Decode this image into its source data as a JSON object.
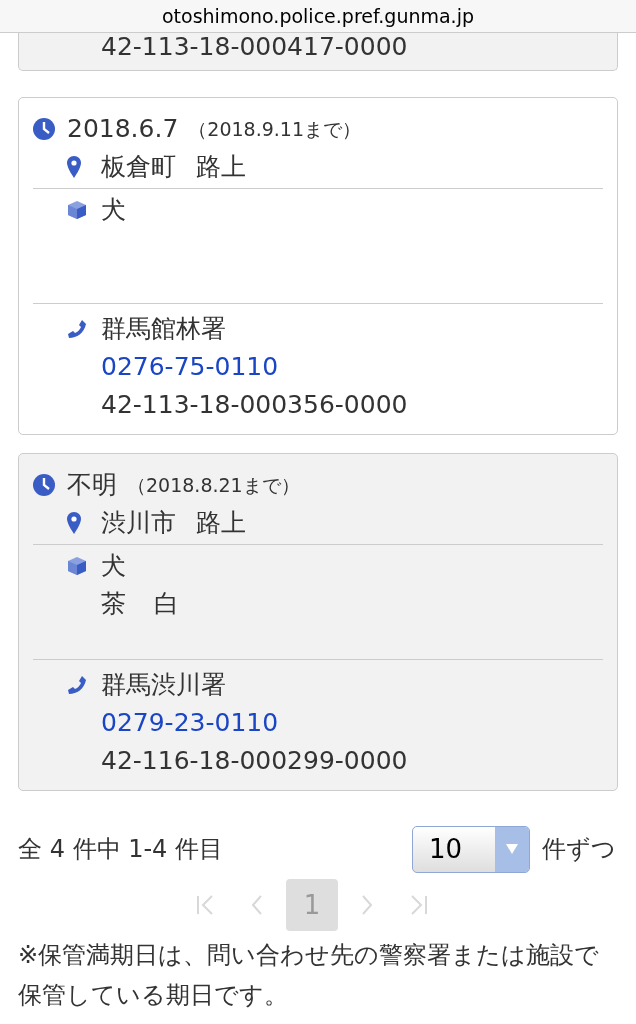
{
  "address_bar": {
    "url": "otoshimono.police.pref.gunma.jp"
  },
  "items": [
    {
      "kind": "partial",
      "shaded": true,
      "receipt_no": "42-113-18-000417-0000"
    },
    {
      "kind": "full",
      "shaded": false,
      "date": "2018.6.7",
      "deadline": "（2018.9.11まで）",
      "place": [
        "板倉町",
        "路上"
      ],
      "details": [
        [
          "犬"
        ]
      ],
      "station": "群馬館林署",
      "phone": "0276-75-0110",
      "receipt_no": "42-113-18-000356-0000"
    },
    {
      "kind": "full",
      "shaded": true,
      "date": "不明",
      "deadline": "（2018.8.21まで）",
      "place": [
        "渋川市",
        "路上"
      ],
      "details": [
        [
          "犬"
        ],
        [
          "茶",
          "白"
        ]
      ],
      "station": "群馬渋川署",
      "phone": "0279-23-0110",
      "receipt_no": "42-116-18-000299-0000"
    }
  ],
  "summary": "全 4 件中 1-4 件目",
  "per_page": {
    "value": "10",
    "suffix": "件ずつ"
  },
  "pager": {
    "nav": [
      {
        "kind": "first",
        "disabled": true
      },
      {
        "kind": "prev",
        "disabled": true
      },
      {
        "kind": "next",
        "disabled": true
      },
      {
        "kind": "last",
        "disabled": true
      }
    ],
    "pages": [
      {
        "label": "1",
        "selected": true
      }
    ]
  },
  "note": "※保管満期日は、問い合わせ先の警察署または施設で保管している期日です。"
}
